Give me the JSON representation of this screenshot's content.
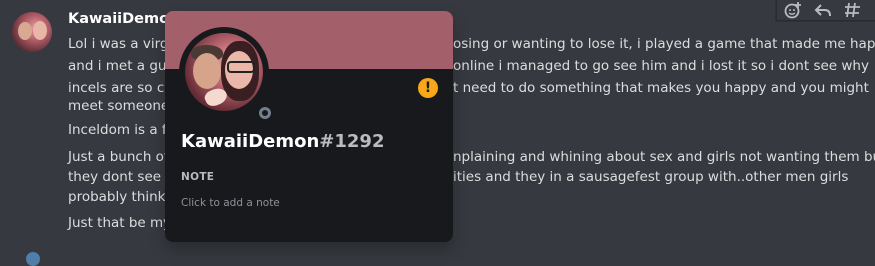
{
  "message": {
    "author": "KawaiiDemon",
    "lines": [
      "Lol i was a virgi",
      "and i met a guy",
      "incels are so cra",
      "meet someone",
      "Inceldom is a fu",
      "Just a bunch of",
      "they dont see th",
      "probably think t",
      "Just that be my"
    ],
    "lines_right": [
      "osing or wanting to lose it, i played a game that made me happy",
      "online i managed to go see him and i lost it  so i dont see why",
      "t need to do something that makes you happy and you might",
      "",
      "",
      "nplaining and whining about sex and girls not wanting them but",
      "ities and they in a sausagefest group with..other men girls",
      "",
      ""
    ]
  },
  "toolbar": {
    "icons": [
      "add-reaction-icon",
      "reply-icon",
      "create-thread-icon"
    ]
  },
  "popout": {
    "username": "KawaiiDemon",
    "discriminator": "#1292",
    "badge_symbol": "!",
    "note_title": "NOTE",
    "note_placeholder": "Click to add a note",
    "banner_color": "#a3606a",
    "status": "offline"
  }
}
